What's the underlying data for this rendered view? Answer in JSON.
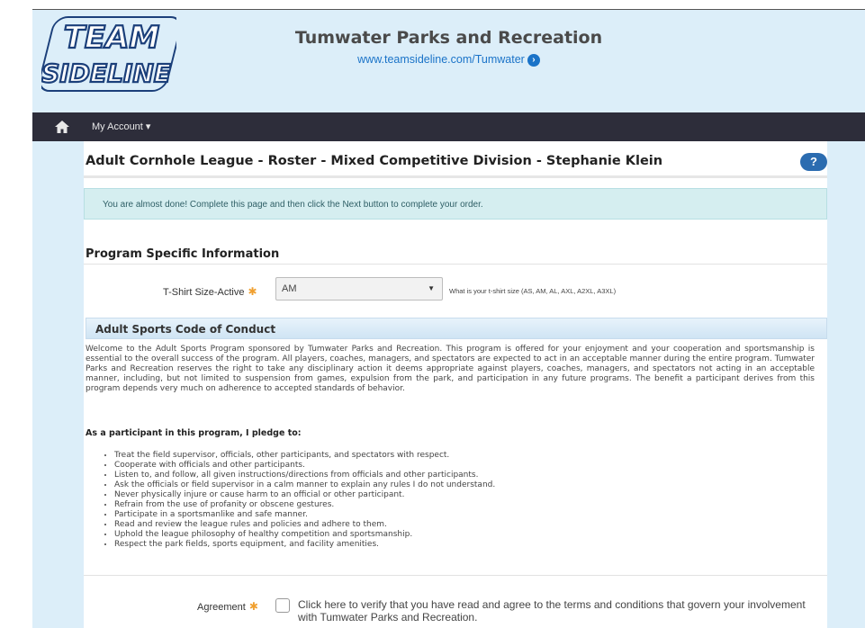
{
  "header": {
    "logo_line1": "TEAM",
    "logo_line2": "SIDELINE",
    "org_title": "Tumwater Parks and Recreation",
    "org_link": "www.teamsideline.com/Tumwater"
  },
  "nav": {
    "home_icon": "home-icon",
    "account_label": "My Account ▾"
  },
  "page": {
    "title": "Adult Cornhole League - Roster - Mixed Competitive Division - Stephanie Klein",
    "help_label": "?",
    "alert": "You are almost done! Complete this page and then click the Next button to complete your order."
  },
  "program_info": {
    "section_title": "Program Specific Information",
    "tshirt_label": "T-Shirt Size-Active",
    "tshirt_value": "AM",
    "tshirt_help": "What is your t-shirt size (AS, AM, AL, AXL, A2XL, A3XL)"
  },
  "conduct": {
    "heading": "Adult Sports Code of Conduct",
    "intro": "Welcome to the Adult Sports Program sponsored by Tumwater Parks and Recreation. This program is offered for your enjoyment and your cooperation and sportsmanship is essential to the overall success of the program. All players, coaches, managers, and spectators are expected to act in an acceptable manner during the entire program. Tumwater Parks and Recreation reserves the right to take any disciplinary action it deems appropriate against players, coaches, managers, and spectators not acting in an acceptable manner, including, but not limited to suspension from games, expulsion from the park, and participation in any future programs. The benefit a participant derives from this program depends very much on adherence to accepted standards of behavior.",
    "pledge_heading": "As a participant in this program, I pledge to:",
    "pledges": [
      "Treat the field supervisor, officials, other participants, and spectators with respect.",
      "Cooperate with officials and other participants.",
      "Listen to, and follow, all given instructions/directions from officials and other participants.",
      "Ask the officials or field supervisor in a calm manner to explain any rules I do not understand.",
      "Never physically injure or cause harm to an official or other participant.",
      "Refrain from the use of profanity or obscene gestures.",
      "Participate in a sportsmanlike and safe manner.",
      "Read and review the league rules and policies and adhere to them.",
      "Uphold the league philosophy of healthy competition and sportsmanship.",
      "Respect the park fields, sports equipment, and facility amenities."
    ]
  },
  "agreement": {
    "label": "Agreement",
    "text": "Click here to verify that you have read and agree to the terms and conditions that govern your involvement with Tumwater Parks and Recreation."
  },
  "colors": {
    "header_bg": "#dceef9",
    "nav_bg": "#2d2d3a",
    "accent": "#1a73c8",
    "required": "#f0a030"
  }
}
